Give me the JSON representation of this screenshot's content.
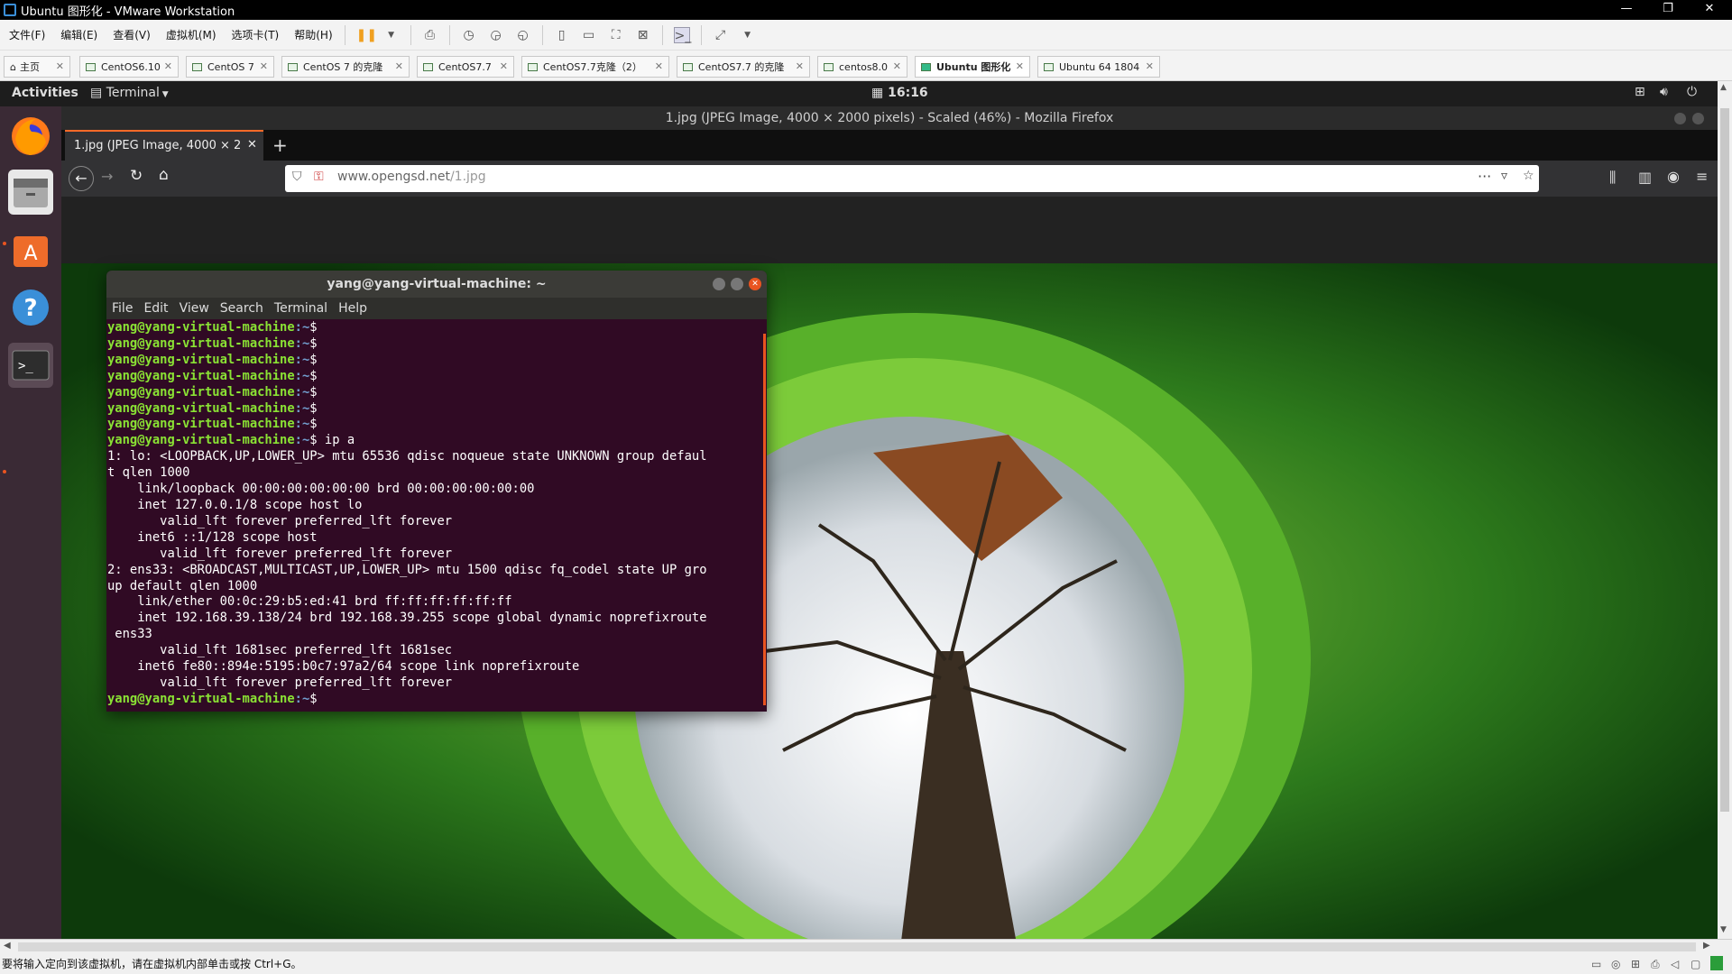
{
  "vmware": {
    "title": "Ubuntu 图形化 - VMware Workstation",
    "window_controls": [
      "—",
      "❐",
      "✕"
    ],
    "menu": [
      "文件(F)",
      "编辑(E)",
      "查看(V)",
      "虚拟机(M)",
      "选项卡(T)",
      "帮助(H)"
    ],
    "tabs": [
      {
        "label": "主页",
        "active": false
      },
      {
        "label": "CentOS6.10",
        "active": false
      },
      {
        "label": "CentOS 7",
        "active": false
      },
      {
        "label": "CentOS 7 的克隆",
        "active": false
      },
      {
        "label": "CentOS7.7",
        "active": false
      },
      {
        "label": "CentOS7.7克隆（2）",
        "active": false
      },
      {
        "label": "CentOS7.7 的克隆",
        "active": false
      },
      {
        "label": "centos8.0",
        "active": false
      },
      {
        "label": "Ubuntu 图形化",
        "active": true
      },
      {
        "label": "Ubuntu 64 1804",
        "active": false
      }
    ],
    "status_text": "要将输入定向到该虚拟机，请在虚拟机内部单击或按 Ctrl+G。"
  },
  "gnome": {
    "activities": "Activities",
    "app_menu": "Terminal",
    "clock": "16:16"
  },
  "firefox": {
    "window_title": "1.jpg (JPEG Image, 4000 × 2000 pixels) - Scaled (46%) - Mozilla Firefox",
    "tab_label": "1.jpg (JPEG Image, 4000 × 2",
    "url_domain": "www.opengsd.net",
    "url_path": "/1.jpg"
  },
  "terminal": {
    "title": "yang@yang-virtual-machine: ~",
    "menu": [
      "File",
      "Edit",
      "View",
      "Search",
      "Terminal",
      "Help"
    ],
    "prompt_user": "yang@yang-virtual-machine",
    "prompt_path": ":~",
    "prompt_sym": "$",
    "command": " ip a",
    "output": [
      "1: lo: <LOOPBACK,UP,LOWER_UP> mtu 65536 qdisc noqueue state UNKNOWN group defaul",
      "t qlen 1000",
      "    link/loopback 00:00:00:00:00:00 brd 00:00:00:00:00:00",
      "    inet 127.0.0.1/8 scope host lo",
      "       valid_lft forever preferred_lft forever",
      "    inet6 ::1/128 scope host",
      "       valid_lft forever preferred_lft forever",
      "2: ens33: <BROADCAST,MULTICAST,UP,LOWER_UP> mtu 1500 qdisc fq_codel state UP gro",
      "up default qlen 1000",
      "    link/ether 00:0c:29:b5:ed:41 brd ff:ff:ff:ff:ff:ff",
      "    inet 192.168.39.138/24 brd 192.168.39.255 scope global dynamic noprefixroute",
      " ens33",
      "       valid_lft 1681sec preferred_lft 1681sec",
      "    inet6 fe80::894e:5195:b0c7:97a2/64 scope link noprefixroute",
      "       valid_lft forever preferred_lft forever"
    ]
  }
}
